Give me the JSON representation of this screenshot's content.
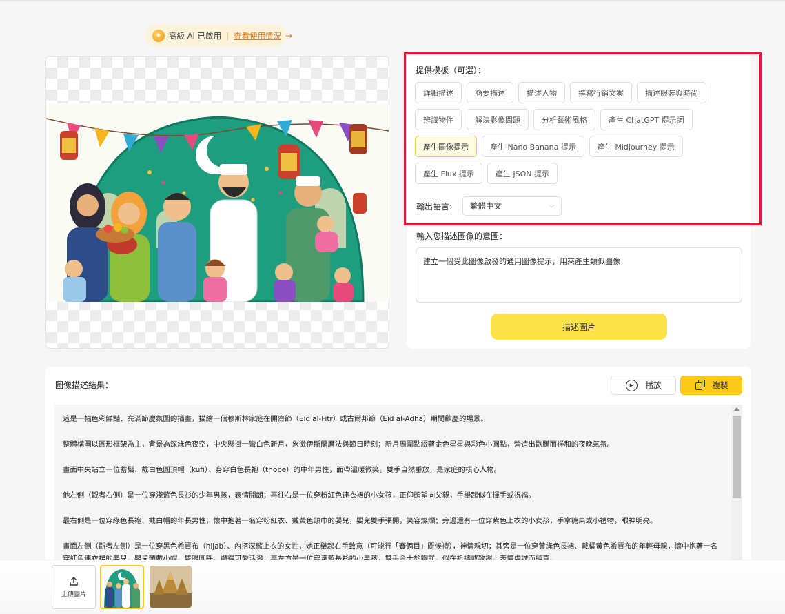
{
  "status": {
    "text": "高級 AI 已啟用",
    "separator": "|",
    "link": "查看使用情況",
    "arrow": "→"
  },
  "templates": {
    "title": "提供模板（可選）：",
    "chips": [
      {
        "label": "詳細描述",
        "active": false
      },
      {
        "label": "簡要描述",
        "active": false
      },
      {
        "label": "描述人物",
        "active": false
      },
      {
        "label": "撰寫行銷文案",
        "active": false
      },
      {
        "label": "描述服裝與時尚",
        "active": false
      },
      {
        "label": "辨識物件",
        "active": false
      },
      {
        "label": "解決影像問題",
        "active": false
      },
      {
        "label": "分析藝術風格",
        "active": false
      },
      {
        "label": "產生 ChatGPT 提示詞",
        "active": false
      },
      {
        "label": "產生圖像提示",
        "active": true
      },
      {
        "label": "產生 Nano Banana 提示",
        "active": false
      },
      {
        "label": "產生 Midjourney 提示",
        "active": false
      },
      {
        "label": "產生 Flux 提示",
        "active": false
      },
      {
        "label": "產生 JSON 提示",
        "active": false
      }
    ]
  },
  "output_language": {
    "label": "輸出語言:",
    "value": "繁體中文"
  },
  "intent": {
    "label": "輸入您描述圖像的意圖：",
    "value": "建立一個受此圖像啟發的通用圖像提示，用來產生類似圖像"
  },
  "describe_button": "描述圖片",
  "result": {
    "label": "圖像描述結果：",
    "play": "播放",
    "copy": "複製",
    "paragraphs": [
      "這是一幅色彩鮮豔、充滿節慶氛圍的插畫，描繪一個穆斯林家庭在開齋節（Eid al-Fitr）或古爾邦節（Eid al-Adha）期間歡慶的場景。",
      "整體構圖以圓形框架為主，背景為深綠色夜空，中央懸掛一彎白色新月，象徵伊斯蘭曆法與節日時刻；新月周圍點綴著金色星星與彩色小圓點，營造出歡騰而祥和的夜晚氣氛。",
      "畫面中央站立一位蓄鬚、戴白色圓頂帽（kufi）、身穿白色長袍（thobe）的中年男性，面帶溫暖微笑，雙手自然垂放，是家庭的核心人物。",
      "他左側（觀者右側）是一位穿淺藍色長衫的少年男孩，表情開朗；再往右是一位穿粉紅色連衣裙的小女孩，正仰頭望向父親，手舉起似在揮手或祝福。",
      "最右側是一位穿綠色長袍、戴白帽的年長男性，懷中抱著一名穿粉紅衣、戴黃色頭巾的嬰兒，嬰兒雙手張開，笑容燦爛；旁邊還有一位穿紫色上衣的小女孩，手拿糖果或小禮物，眼神明亮。",
      "畫面左側（觀者左側）是一位穿黑色希賈布（hijab）、內搭深藍上衣的女性，她正舉起右手致意（可能行「賽俩目」問候禮），神情親切；其旁是一位穿黃綠色長裙、戴橘黃色希賈布的年輕母親，懷中抱著一名穿紅色連衣裙的嬰兒，嬰兒頭戴小帽，雙眼圓睜，顯得可愛活潑；再左方是一位穿淺藍長衫的小男孩，雙手合十於胸前，似在祈禱或致謝，表情虔誠而純真。"
    ]
  },
  "bottom": {
    "upload_label": "上傳圖片"
  },
  "colors": {
    "accent_yellow": "#fbc91b",
    "button_yellow": "#fde24a",
    "highlight_red": "#e3192f",
    "link_orange": "#e57b1d"
  }
}
